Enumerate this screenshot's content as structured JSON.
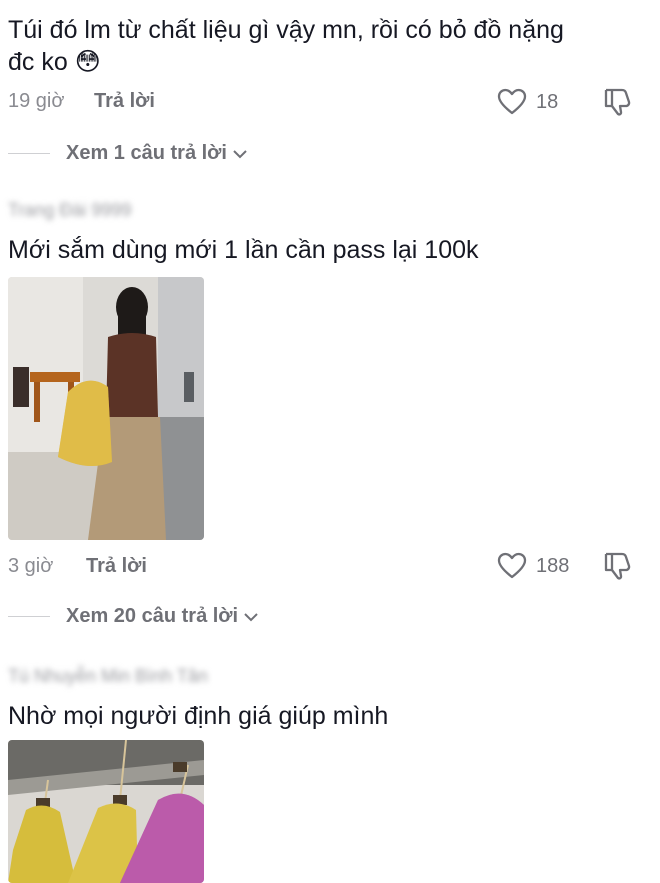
{
  "comments": [
    {
      "text_line1": "Túi đó lm từ chất liệu gì vậy mn, rồi có bỏ đồ nặng",
      "text_line2": "đc ko",
      "emoji": "😳",
      "time": "19 giờ",
      "reply_label": "Trả lời",
      "likes": "18",
      "view_replies": "Xem 1 câu trả lời"
    },
    {
      "author": "Trang Đài 9999",
      "text": "Mới sắm dùng mới 1 lần cần pass lại 100k",
      "time": "3 giờ",
      "reply_label": "Trả lời",
      "likes": "188",
      "view_replies": "Xem 20 câu trả lời"
    },
    {
      "author": "Tú Nhuyễn Min Bình Tân",
      "text": "Nhờ mọi người định giá giúp mình"
    }
  ],
  "colors": {
    "text": "#161823",
    "muted": "#8a8b91",
    "icon": "#6f7076"
  }
}
